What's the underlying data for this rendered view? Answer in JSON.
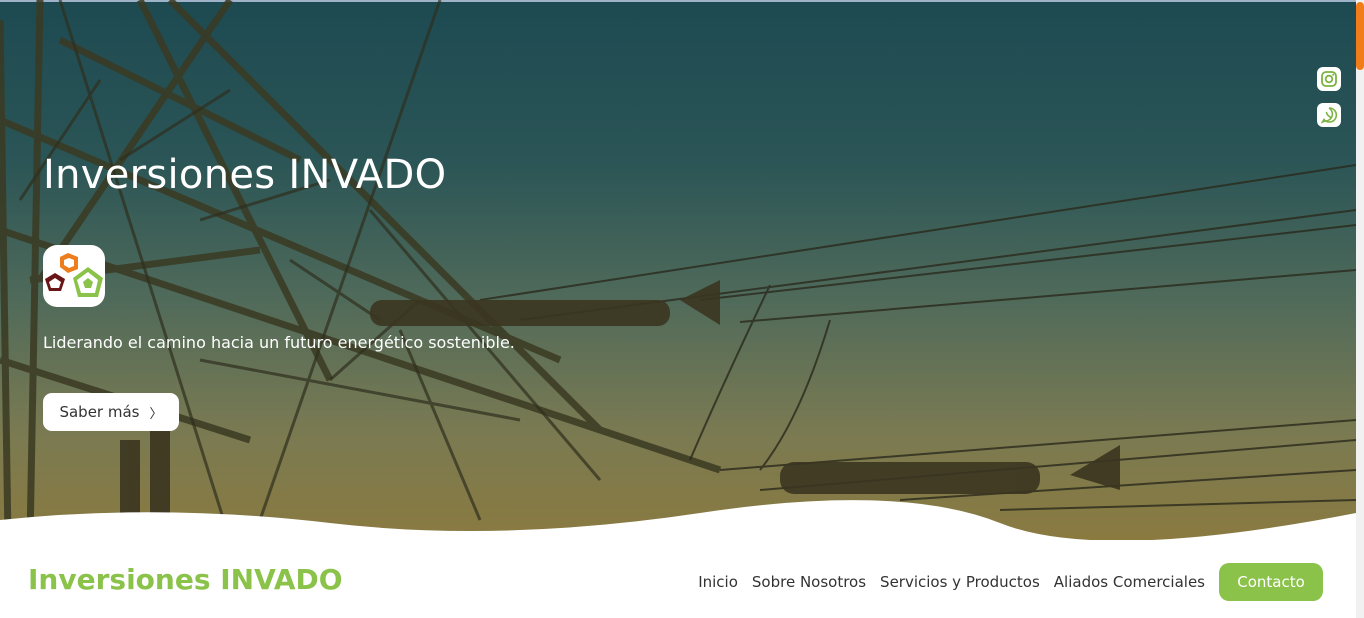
{
  "hero": {
    "title": "Inversiones INVADO",
    "tagline": "Liderando el camino hacia un futuro energético sostenible.",
    "button_label": "Saber más",
    "button_chevron": "〉"
  },
  "social": {
    "instagram_icon": "instagram-icon",
    "whatsapp_icon": "whatsapp-icon"
  },
  "navbar": {
    "brand": "Inversiones INVADO",
    "links": [
      "Inicio",
      "Sobre Nosotros",
      "Servicios y Productos",
      "Aliados Comerciales"
    ],
    "cta": "Contacto"
  },
  "colors": {
    "accent_green": "#8bc34a",
    "logo_orange": "#ee7d1e",
    "logo_maroon": "#6b1616",
    "scroll_thumb": "#f07d1a"
  }
}
